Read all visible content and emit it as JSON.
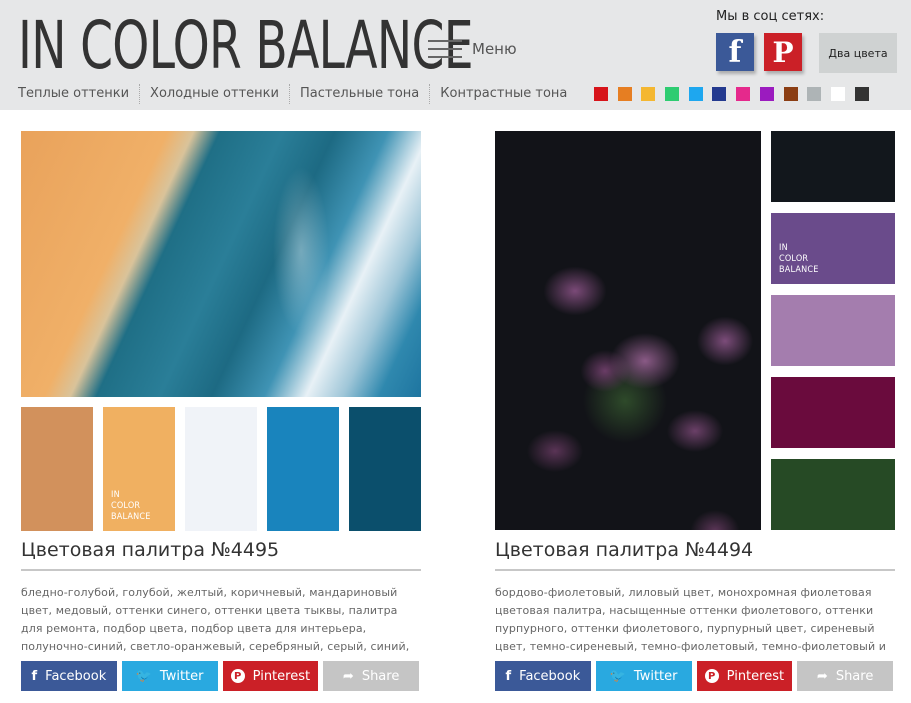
{
  "header": {
    "logo": "IN COLOR BALANCE",
    "menu_label": "Меню",
    "nav": [
      "Теплые оттенки",
      "Холодные оттенки",
      "Пастельные тона",
      "Контрастные тона"
    ],
    "social_label": "Мы в соц сетях:",
    "facebook_icon_glyph": "f",
    "pinterest_icon_glyph": "P",
    "two_colors_label": "Два цвета",
    "color_filters": [
      "#d7141a",
      "#e67e22",
      "#f4b731",
      "#2ecc71",
      "#1ea7ef",
      "#243a8f",
      "#e5298c",
      "#9b1bbf",
      "#8b3e14",
      "#aeb4b6",
      "#ffffff",
      "#333333"
    ]
  },
  "mini_logo": [
    "IN",
    "COLOR",
    "BALANCE"
  ],
  "cards": [
    {
      "title": "Цветовая палитра №4495",
      "description": "бледно-голубой, голубой, желтый, коричневый, мандариновый цвет, медовый, оттенки синего, оттенки цвета тыквы, палитра для ремонта, подбор цвета, подбор цвета для интерьера, полуночно-синий, светло-оранжевый, серебряный, серый, синий, темно-синий,",
      "palette": [
        "#d2915c",
        "#f0b061",
        "#f0f3f8",
        "#1984bd",
        "#0b4f6c"
      ],
      "photo": "beach-ocean-aerial"
    },
    {
      "title": "Цветовая палитра №4494",
      "description": "бордово-фиолетовый, лиловый цвет, монохромная фиолетовая цветовая палитра, насыщенные оттенки фиолетового, оттенки пурпурного, оттенки фиолетового, пурпурный цвет, сиреневый цвет, темно-сиреневый, темно-фиолетовый, темно-фиолетовый и",
      "palette": [
        "#12171c",
        "#6a4b8b",
        "#a47dae",
        "#6a0b3d",
        "#264a25"
      ],
      "photo": "dark-purple-flowers"
    }
  ],
  "share": {
    "facebook": "Facebook",
    "twitter": "Twitter",
    "pinterest": "Pinterest",
    "share": "Share",
    "facebook_glyph": "f",
    "twitter_glyph": "🐦",
    "pinterest_glyph": "P",
    "share_glyph": "➦"
  }
}
